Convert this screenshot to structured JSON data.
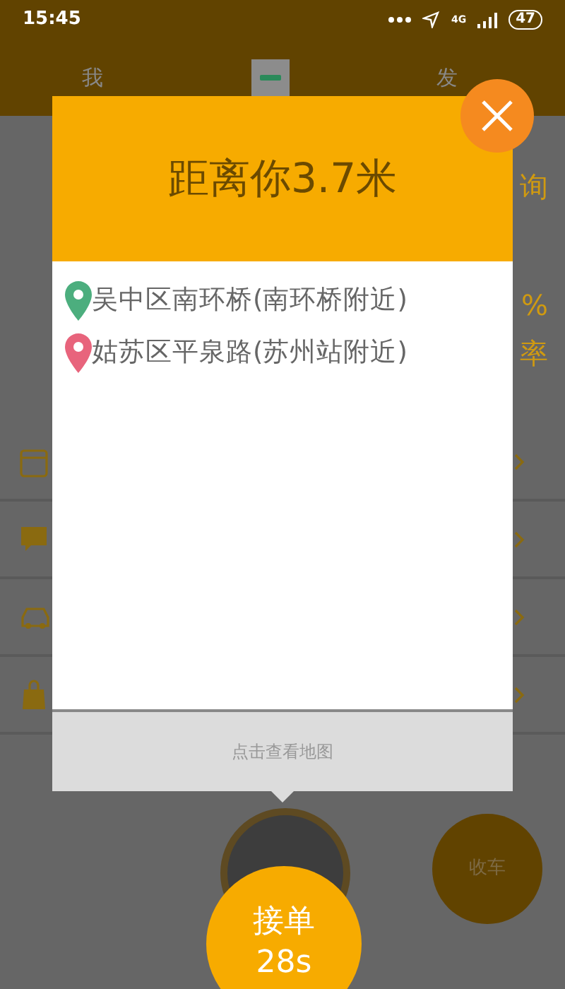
{
  "status_bar": {
    "time": "15:45",
    "network": "4G",
    "battery": "47"
  },
  "top_nav": {
    "left": "我",
    "right": "发"
  },
  "stats": {
    "top_right": "询",
    "percent": "%",
    "right_label": "率"
  },
  "menu_rows": [
    {
      "kind": "calendar"
    },
    {
      "kind": "message"
    },
    {
      "kind": "car"
    },
    {
      "kind": "bag"
    }
  ],
  "dialog": {
    "title": "距离你3.7米",
    "addresses": [
      {
        "color": "#4cae7e",
        "text": "吴中区南环桥(南环桥附近)"
      },
      {
        "color": "#e8647c",
        "text": "姑苏区平泉路(苏州站附近)"
      }
    ],
    "footer": "点击查看地图"
  },
  "accept_button": {
    "label": "接单",
    "countdown": "28s"
  },
  "stop_button": {
    "label": "收车"
  }
}
